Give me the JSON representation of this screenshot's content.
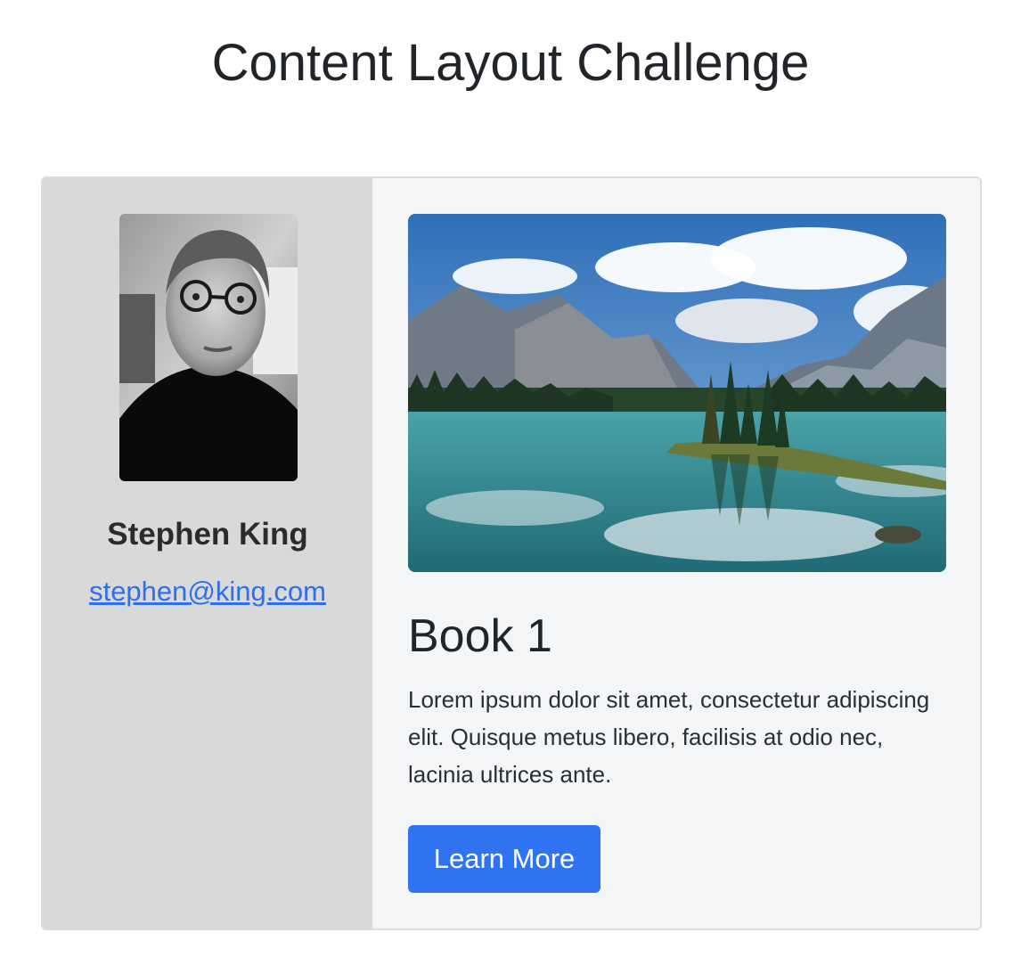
{
  "page": {
    "title": "Content Layout Challenge"
  },
  "author": {
    "name": "Stephen King",
    "email": "stephen@king.com",
    "photo": "author-portrait"
  },
  "book": {
    "image": "mountain-lake-landscape",
    "title": "Book 1",
    "description": "Lorem ipsum dolor sit amet, consectetur adipiscing elit. Quisque metus libero, facilisis at odio nec, lacinia ultrices ante.",
    "button_label": "Learn More"
  },
  "colors": {
    "sidebar_bg": "#d9d9d9",
    "card_bg": "#f4f5f7",
    "link": "#2f6fea",
    "button": "#2f73f0"
  }
}
